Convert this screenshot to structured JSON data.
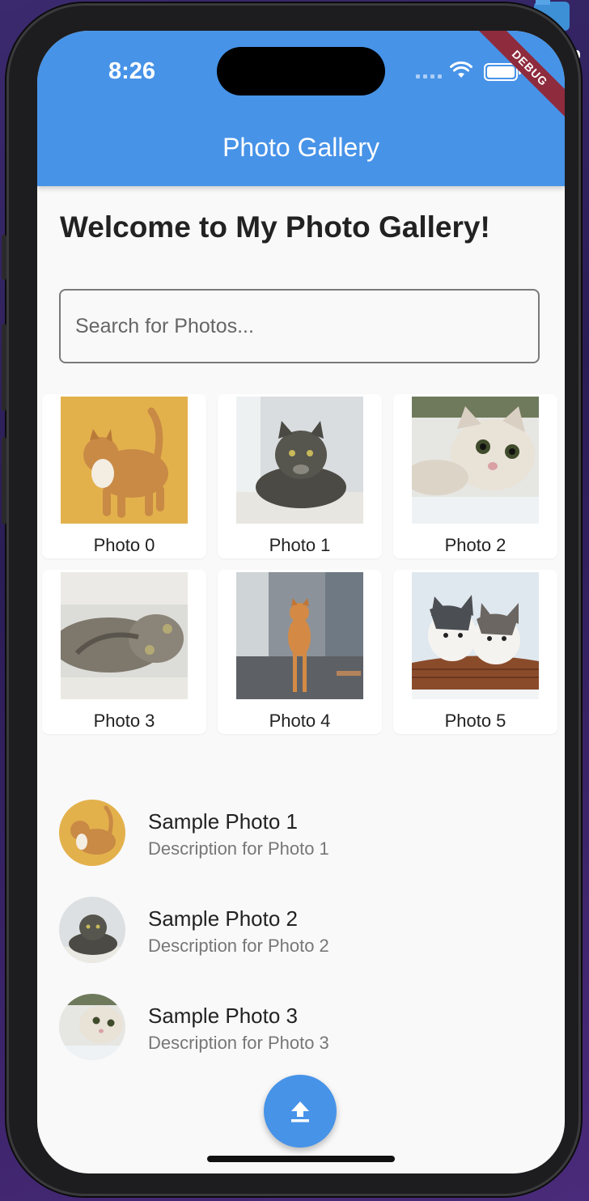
{
  "status_bar": {
    "time": "8:26",
    "debug_label": "DEBUG"
  },
  "app_bar": {
    "title": "Photo Gallery"
  },
  "main": {
    "welcome": "Welcome to My Photo Gallery!",
    "search": {
      "placeholder": "Search for Photos...",
      "value": ""
    },
    "grid": [
      {
        "label": "Photo 0"
      },
      {
        "label": "Photo 1"
      },
      {
        "label": "Photo 2"
      },
      {
        "label": "Photo 3"
      },
      {
        "label": "Photo 4"
      },
      {
        "label": "Photo 5"
      }
    ],
    "list": [
      {
        "title": "Sample Photo 1",
        "subtitle": "Description for Photo 1"
      },
      {
        "title": "Sample Photo 2",
        "subtitle": "Description for Photo 2"
      },
      {
        "title": "Sample Photo 3",
        "subtitle": "Description for Photo 3"
      }
    ]
  },
  "fab": {
    "icon": "upload-icon"
  },
  "colors": {
    "primary": "#4793e8",
    "background": "#f9f9f9",
    "debug_banner": "#8e2b3d"
  }
}
